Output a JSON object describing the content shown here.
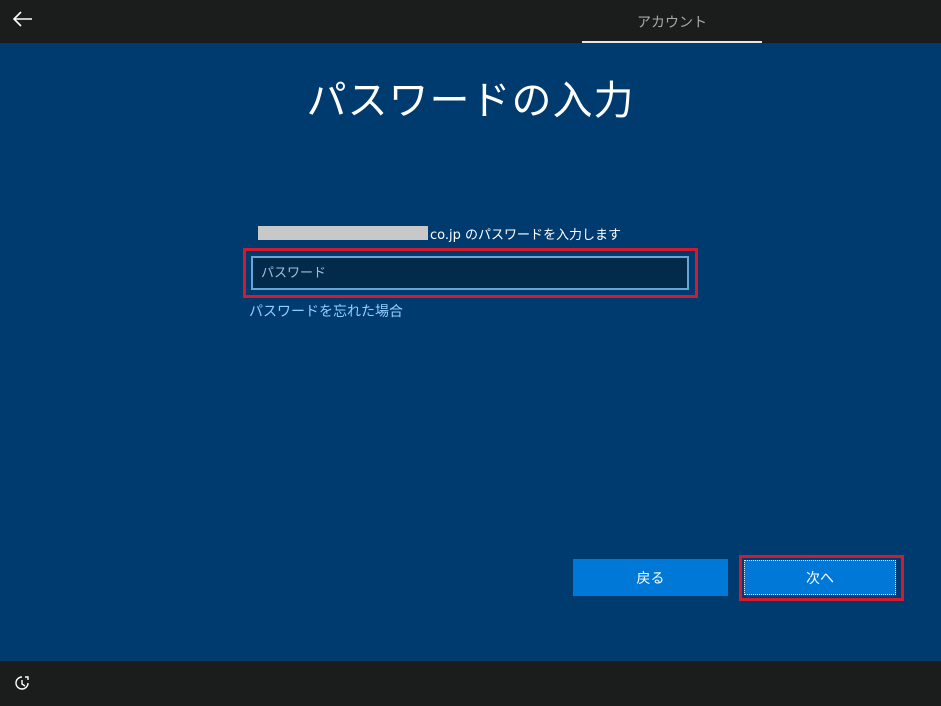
{
  "header": {
    "back_icon": "back-arrow-icon",
    "tab_label": "アカウント"
  },
  "main": {
    "title": "パスワードの入力",
    "prompt_suffix": "co.jp のパスワードを入力します",
    "password_placeholder": "パスワード",
    "password_value": "",
    "forgot_link": "パスワードを忘れた場合"
  },
  "buttons": {
    "back_label": "戻る",
    "next_label": "次へ"
  },
  "footer": {
    "ease_icon": "ease-of-access-icon"
  },
  "colors": {
    "background": "#003b6f",
    "bar": "#1b1d1c",
    "button": "#0078d7",
    "highlight": "#d21b2d",
    "link": "#8fd0ff"
  }
}
